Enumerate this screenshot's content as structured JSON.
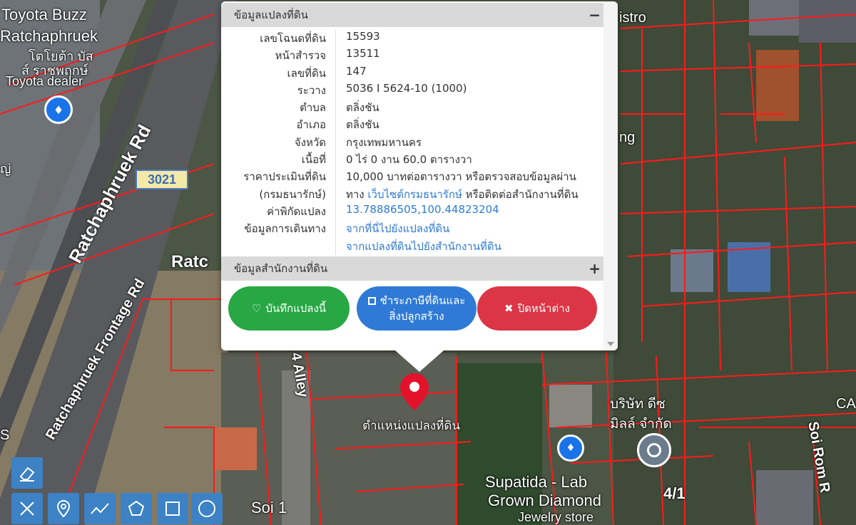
{
  "map": {
    "labels": {
      "toyota_buzz": "Toyota Buzz",
      "ratchaphruek_top": "Ratchaphruek",
      "thai1": "โตโยต้า บัส",
      "thai2": "ส์ ราชพฤกษ์",
      "toyota_dealer": "Toyota dealer",
      "istro": "istro",
      "ratchaphruek_rd": "Ratchaphruek Rd",
      "road_number": "3021",
      "ratc": "Ratc",
      "frontage_rd": "Ratchaphruek Frontage Rd",
      "alley": "4 Alley",
      "soi1": "Soi 1",
      "marker_label": "ตำแหน่งแปลงที่ดิน",
      "company": "บริษัท ดีซ",
      "company2": "มิลล์ จำกัด",
      "ca": "CA",
      "soi_rom": "Soi Rom R",
      "supatida": "Supatida - Lab",
      "grown": "Grown Diamond",
      "jewelry": "Jewelry store",
      "num41": "4/1",
      "side_thai": "ญ่",
      "s_letter": "S",
      "ng": "ng"
    }
  },
  "popup": {
    "section1_title": "ข้อมูลแปลงที่ดิน",
    "section1_toggle": "−",
    "fields": [
      {
        "label": "เลขโฉนดที่ดิน",
        "value": "15593"
      },
      {
        "label": "หน้าสำรวจ",
        "value": "13511"
      },
      {
        "label": "เลขที่ดิน",
        "value": "147"
      },
      {
        "label": "ระวาง",
        "value": "5036 I 5624-10 (1000)"
      },
      {
        "label": "ตำบล",
        "value": "ตลิ่งชัน"
      },
      {
        "label": "อำเภอ",
        "value": "ตลิ่งชัน"
      },
      {
        "label": "จังหวัด",
        "value": "กรุงเทพมหานคร"
      },
      {
        "label": "เนื้อที่",
        "value": "0 ไร่ 0 งาน 60.0 ตารางวา"
      }
    ],
    "price_label": "ราคาประเมินที่ดิน",
    "price_value": "10,000 บาทต่อตารางวา หรือตรวจสอบข้อมูลผ่าน",
    "dept_label": "(กรมธนารักษ์)",
    "dept_prefix": "ทาง ",
    "dept_link": "เว็บไซต์กรมธนารักษ์",
    "dept_suffix": " หรือติดต่อสำนักงานที่ดิน",
    "coord_label": "ค่าพิกัดแปลง",
    "coord_value": "13.78886505,100.44823204",
    "travel_label": "ข้อมูลการเดินทาง",
    "travel_link1": "จากที่นี่ไปยังแปลงที่ดิน",
    "travel_link2": "จากแปลงที่ดินไปยังสำนักงานที่ดิน",
    "section2_title": "ข้อมูลสำนักงานที่ดิน",
    "section2_toggle": "+",
    "buttons": {
      "save": "บันทึกแปลงนี้",
      "tax_line1": "ชำระภาษีที่ดินและ",
      "tax_line2": "สิ่งปลูกสร้าง",
      "close": "ปิดหน้าต่าง"
    }
  },
  "icons": {
    "save": "heart-icon",
    "tax": "qrcode-icon",
    "close": "times-icon",
    "eraser": "eraser-icon",
    "ruler": "ruler-pencil-icon",
    "marker": "map-marker-icon",
    "polyline": "polyline-icon",
    "polygon": "polygon-icon",
    "rectangle": "rectangle-icon",
    "circle": "circle-icon"
  },
  "colors": {
    "parcel_line": "#ff1a1a",
    "marker": "#e3122a",
    "btn_green": "#27a844",
    "btn_blue": "#2f7ad6",
    "btn_red": "#dc3545",
    "toolbar": "#3c82c4"
  }
}
